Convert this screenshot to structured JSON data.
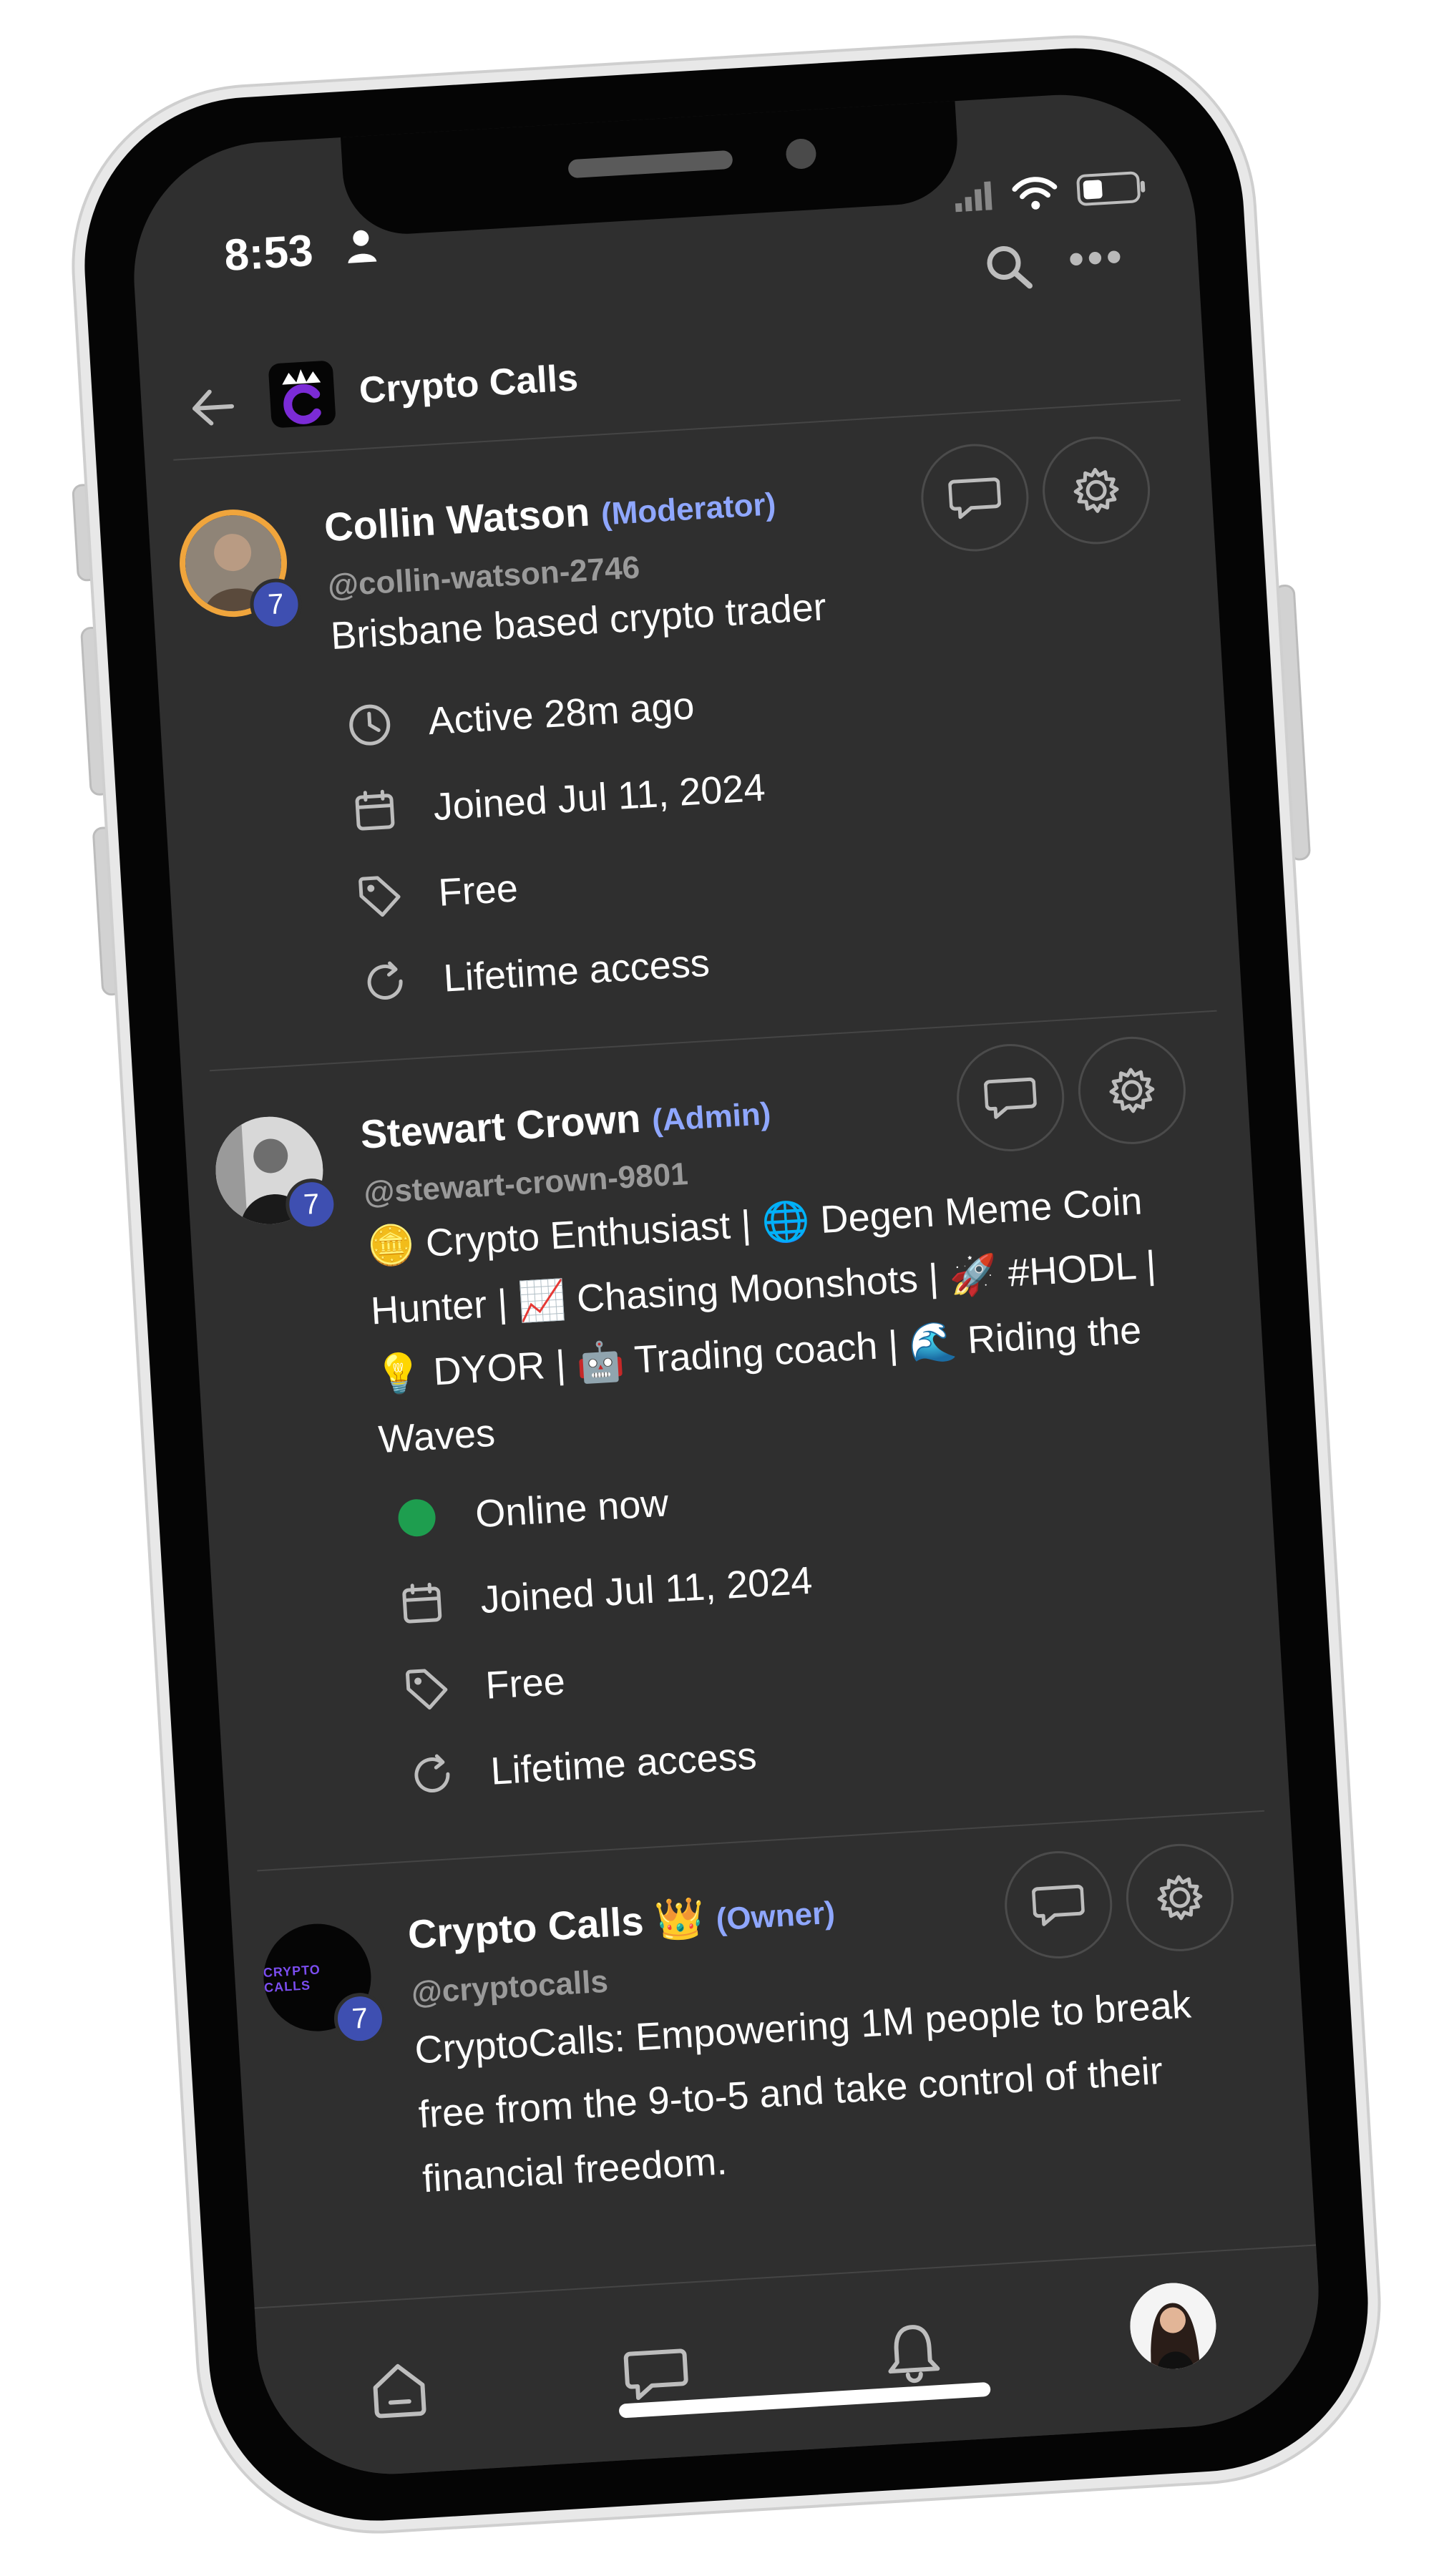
{
  "status_bar": {
    "time": "8:53"
  },
  "header": {
    "title": "Crypto Calls"
  },
  "members": [
    {
      "name": "Collin Watson",
      "role": "(Moderator)",
      "handle": "@collin-watson-2746",
      "level": "7",
      "bio": "Brisbane based crypto trader",
      "activity": "Active 28m ago",
      "joined": "Joined Jul 11, 2024",
      "price": "Free",
      "access": "Lifetime access"
    },
    {
      "name": "Stewart Crown",
      "role": "(Admin)",
      "handle": "@stewart-crown-9801",
      "level": "7",
      "bio": "🪙 Crypto Enthusiast | 🌐 Degen Meme Coin Hunter | 📈 Chasing Moonshots | 🚀 #HODL | 💡 DYOR | 🤖 Trading coach | 🌊 Riding the Waves",
      "activity": "Online now",
      "joined": "Joined Jul 11, 2024",
      "price": "Free",
      "access": "Lifetime access"
    },
    {
      "name": "Crypto Calls 👑",
      "role": "(Owner)",
      "handle": "@cryptocalls",
      "level": "7",
      "logo_text": "CRYPTO CALLS",
      "bio": "CryptoCalls: Empowering 1M people to break free from the 9-to-5 and take control of their financial freedom."
    }
  ],
  "colors": {
    "background": "#2f2f2f",
    "role": "#8fa7ff",
    "level_badge": "#3e4fb1",
    "online": "#1e9e4f"
  },
  "icons": {
    "top": [
      "search-icon",
      "more-icon"
    ],
    "meta": [
      "clock-icon",
      "calendar-icon",
      "tag-icon",
      "refresh-icon",
      "online-dot-icon"
    ],
    "nav": [
      "home-icon",
      "chat-icon",
      "bell-icon"
    ]
  }
}
